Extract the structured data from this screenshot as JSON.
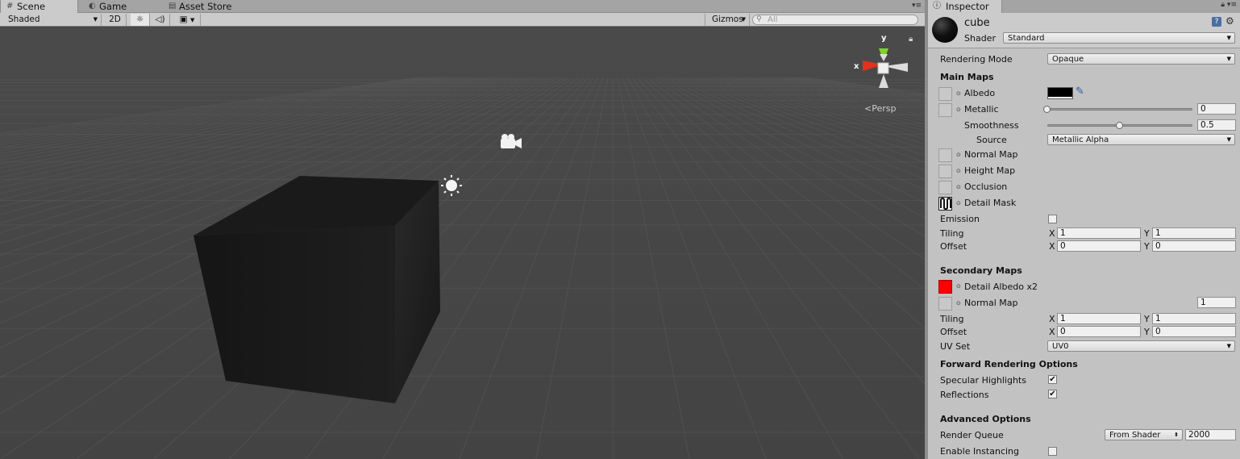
{
  "scene_tabs": {
    "scene": "Scene",
    "game": "Game",
    "asset_store": "Asset Store"
  },
  "scene_toolbar": {
    "draw_mode": "Shaded",
    "mode_2d": "2D",
    "gizmos": "Gizmos",
    "search_placeholder": "All"
  },
  "viewport": {
    "axis_x": "x",
    "axis_y": "y",
    "projection": "Persp"
  },
  "inspector": {
    "tab": "Inspector",
    "material_name": "cube",
    "shader_label": "Shader",
    "shader_value": "Standard",
    "rendering_mode_label": "Rendering Mode",
    "rendering_mode_value": "Opaque",
    "main_maps": {
      "header": "Main Maps",
      "albedo": "Albedo",
      "albedo_color": "#000000",
      "metallic": "Metallic",
      "metallic_value": "0",
      "metallic_fraction": 0,
      "smoothness": "Smoothness",
      "smoothness_value": "0.5",
      "smoothness_fraction": 0.5,
      "source": "Source",
      "source_value": "Metallic Alpha",
      "normal_map": "Normal Map",
      "height_map": "Height Map",
      "occlusion": "Occlusion",
      "detail_mask": "Detail Mask",
      "emission": "Emission",
      "tiling": "Tiling",
      "tiling_x": "1",
      "tiling_y": "1",
      "offset": "Offset",
      "offset_x": "0",
      "offset_y": "0"
    },
    "secondary_maps": {
      "header": "Secondary Maps",
      "detail_albedo": "Detail Albedo x2",
      "detail_albedo_color": "#ff0000",
      "normal_map": "Normal Map",
      "normal_scale": "1",
      "tiling": "Tiling",
      "tiling_x": "1",
      "tiling_y": "1",
      "offset": "Offset",
      "offset_x": "0",
      "offset_y": "0",
      "uv_set": "UV Set",
      "uv_set_value": "UV0"
    },
    "forward_options": {
      "header": "Forward Rendering Options",
      "specular_highlights": "Specular Highlights",
      "specular_checked": true,
      "reflections": "Reflections",
      "reflections_checked": true
    },
    "advanced": {
      "header": "Advanced Options",
      "render_queue": "Render Queue",
      "render_queue_mode": "From Shader",
      "render_queue_value": "2000",
      "enable_instancing": "Enable Instancing",
      "instancing_checked": false
    },
    "axis_x_label": "X",
    "axis_y_label": "Y"
  }
}
